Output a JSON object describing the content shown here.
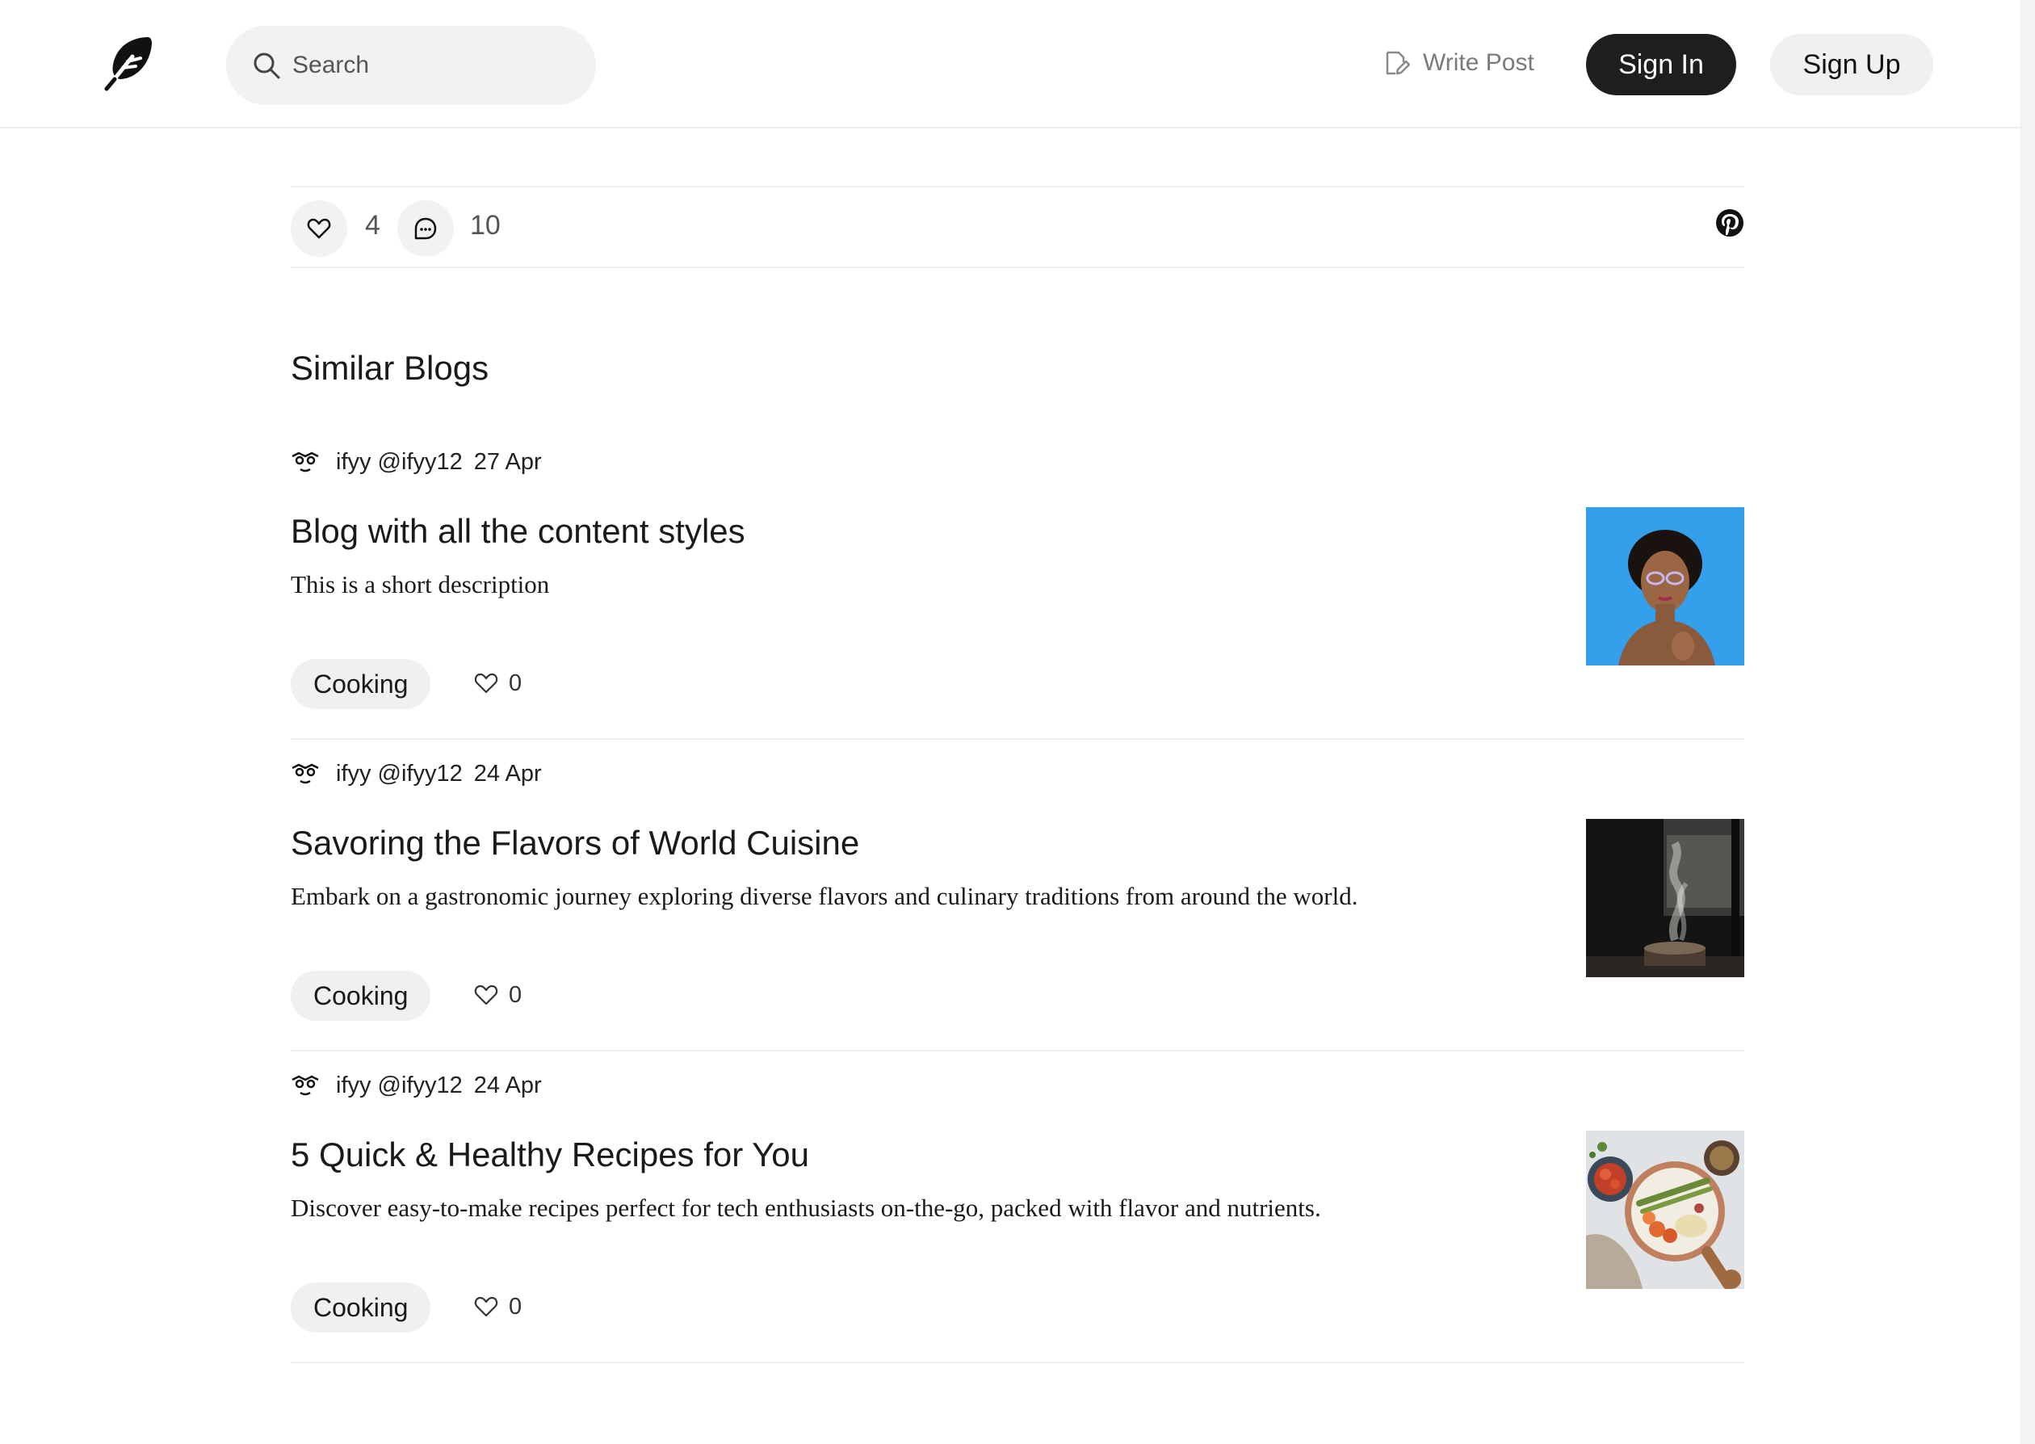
{
  "header": {
    "search_placeholder": "Search",
    "write_post_label": "Write Post",
    "sign_in_label": "Sign In",
    "sign_up_label": "Sign Up"
  },
  "reactions": {
    "likes_count": "4",
    "comments_count": "10"
  },
  "similar": {
    "title": "Similar Blogs",
    "posts": [
      {
        "author": "ifyy @ifyy12",
        "date": "27 Apr",
        "title": "Blog with all the content styles",
        "description": "This is a short description",
        "tag": "Cooking",
        "likes": "0",
        "thumbnail": "portrait-photo"
      },
      {
        "author": "ifyy @ifyy12",
        "date": "24 Apr",
        "title": "Savoring the Flavors of World Cuisine",
        "description": "Embark on a gastronomic journey exploring diverse flavors and culinary traditions from around the world.",
        "tag": "Cooking",
        "likes": "0",
        "thumbnail": "steaming-pot-photo"
      },
      {
        "author": "ifyy @ifyy12",
        "date": "24 Apr",
        "title": "5 Quick & Healthy Recipes for You",
        "description": "Discover easy-to-make recipes perfect for tech enthusiasts on-the-go, packed with flavor and nutrients.",
        "tag": "Cooking",
        "likes": "0",
        "thumbnail": "food-bowl-photo"
      }
    ]
  },
  "colors": {
    "primary_button": "#1e1e1e",
    "secondary_button": "#f0f0f0",
    "divider": "#eeeeee"
  }
}
